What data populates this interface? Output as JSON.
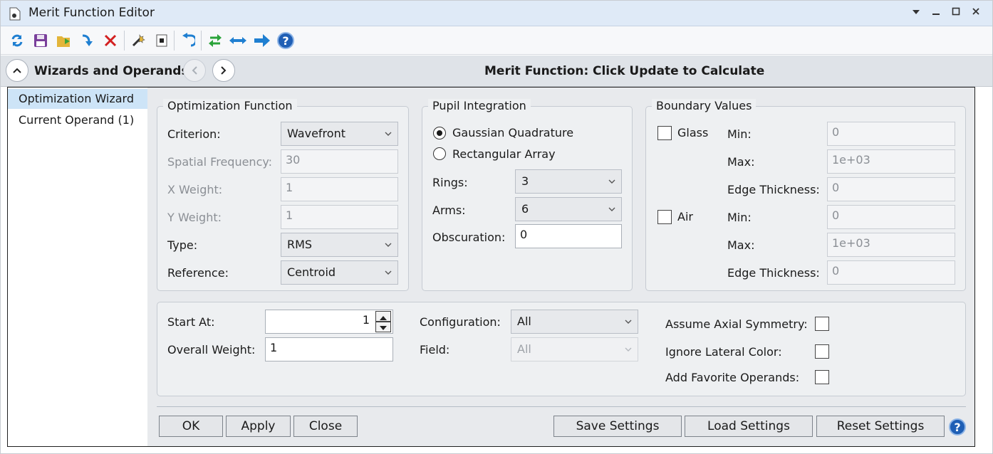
{
  "window": {
    "title": "Merit Function Editor"
  },
  "toolbar": {
    "buttons": [
      "refresh-icon",
      "save-icon",
      "load-icon",
      "insert-icon",
      "delete-icon",
      "wizard-icon",
      "stop-icon",
      "undo-icon",
      "swap-icon",
      "arrows-icon",
      "forward-icon",
      "help-icon"
    ]
  },
  "header": {
    "wizards_title": "Wizards and Operands",
    "merit_label": "Merit Function:",
    "merit_value": "Click Update to Calculate"
  },
  "nav": {
    "items": [
      {
        "label": "Optimization Wizard",
        "selected": true
      },
      {
        "label": "Current Operand (1)",
        "selected": false
      }
    ]
  },
  "optimization_function": {
    "title": "Optimization Function",
    "criterion": {
      "label": "Criterion:",
      "value": "Wavefront"
    },
    "spatial_frequency": {
      "label": "Spatial Frequency:",
      "value": "30"
    },
    "x_weight": {
      "label": "X Weight:",
      "value": "1"
    },
    "y_weight": {
      "label": "Y Weight:",
      "value": "1"
    },
    "type": {
      "label": "Type:",
      "value": "RMS"
    },
    "reference": {
      "label": "Reference:",
      "value": "Centroid"
    }
  },
  "pupil_integration": {
    "title": "Pupil Integration",
    "gaussian": {
      "label": "Gaussian Quadrature",
      "selected": true
    },
    "rectangular": {
      "label": "Rectangular Array",
      "selected": false
    },
    "rings": {
      "label": "Rings:",
      "value": "3"
    },
    "arms": {
      "label": "Arms:",
      "value": "6"
    },
    "obscuration": {
      "label": "Obscuration:",
      "value": "0"
    }
  },
  "boundary_values": {
    "title": "Boundary Values",
    "glass": {
      "label": "Glass",
      "checked": false,
      "min_label": "Min:",
      "min": "0",
      "max_label": "Max:",
      "max": "1e+03",
      "edge_label": "Edge Thickness:",
      "edge": "0"
    },
    "air": {
      "label": "Air",
      "checked": false,
      "min_label": "Min:",
      "min": "0",
      "max_label": "Max:",
      "max": "1e+03",
      "edge_label": "Edge Thickness:",
      "edge": "0"
    }
  },
  "misc": {
    "start_at": {
      "label": "Start At:",
      "value": "1"
    },
    "overall_weight": {
      "label": "Overall Weight:",
      "value": "1"
    },
    "configuration": {
      "label": "Configuration:",
      "value": "All"
    },
    "field": {
      "label": "Field:",
      "value": "All"
    },
    "assume_axial": {
      "label": "Assume Axial Symmetry:",
      "checked": false
    },
    "ignore_lateral": {
      "label": "Ignore Lateral Color:",
      "checked": false
    },
    "add_favorite": {
      "label": "Add Favorite Operands:",
      "checked": false
    }
  },
  "buttons": {
    "ok": "OK",
    "apply": "Apply",
    "close": "Close",
    "save_settings": "Save Settings",
    "load_settings": "Load Settings",
    "reset_settings": "Reset Settings",
    "help": "?"
  },
  "colors": {
    "accent": "#1f5fb5",
    "selection": "#cde4f7",
    "titlebar": "#dfeaf7"
  }
}
